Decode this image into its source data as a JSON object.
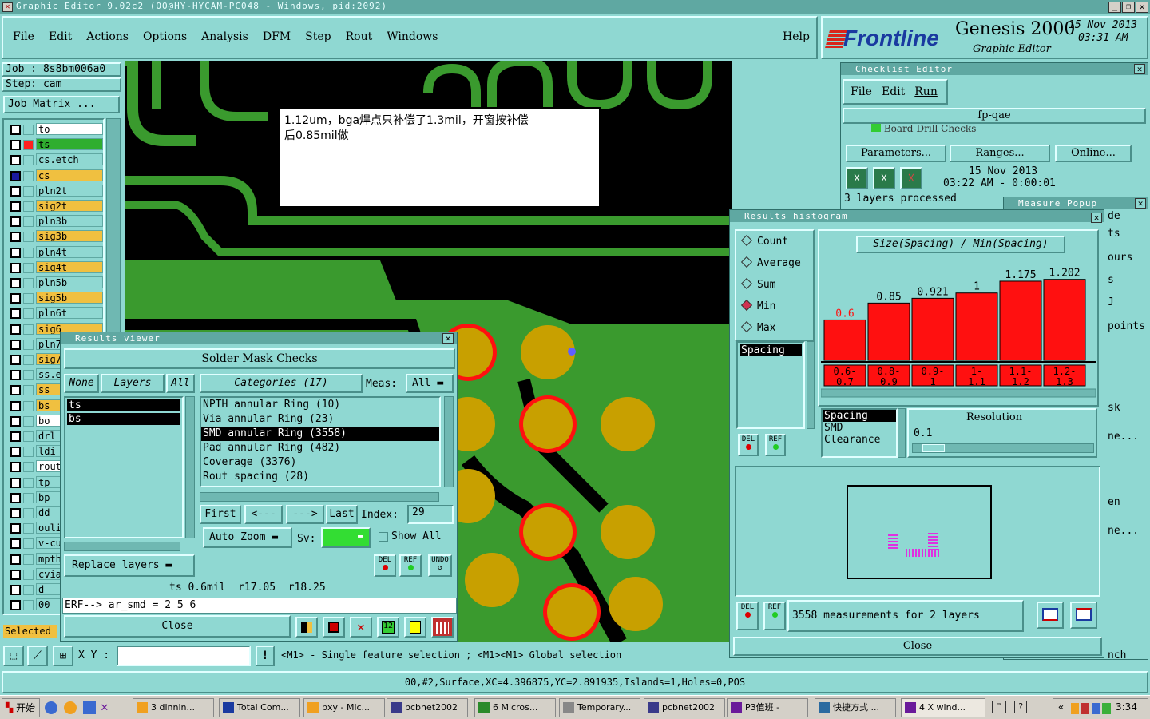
{
  "window": {
    "title": "Graphic Editor 9.02c2  (OO@HY-HYCAM-PC048 - Windows, pid:2092)"
  },
  "menu": [
    "File",
    "Edit",
    "Actions",
    "Options",
    "Analysis",
    "DFM",
    "Step",
    "Rout",
    "Windows"
  ],
  "help_label": "Help",
  "brand": {
    "logo": "Frontline",
    "product": "Genesis 2000",
    "subtitle": "Graphic Editor",
    "date": "15 Nov 2013",
    "time": "03:31 AM"
  },
  "job": {
    "job_label": "Job : 8s8bm006a0",
    "step_label": "Step: cam",
    "matrix_button": "Job Matrix ..."
  },
  "layers": [
    {
      "name": "to",
      "color": "#ffffff"
    },
    {
      "name": "ts",
      "color": "#2fae2f"
    },
    {
      "name": "cs.etch",
      "color": "#8fd8d2"
    },
    {
      "name": "cs",
      "color": "#f0c040"
    },
    {
      "name": "pln2t",
      "color": "#8fd8d2"
    },
    {
      "name": "sig2t",
      "color": "#f0c040"
    },
    {
      "name": "pln3b",
      "color": "#8fd8d2"
    },
    {
      "name": "sig3b",
      "color": "#f0c040"
    },
    {
      "name": "pln4t",
      "color": "#8fd8d2"
    },
    {
      "name": "sig4t",
      "color": "#f0c040"
    },
    {
      "name": "pln5b",
      "color": "#8fd8d2"
    },
    {
      "name": "sig5b",
      "color": "#f0c040"
    },
    {
      "name": "pln6t",
      "color": "#8fd8d2"
    },
    {
      "name": "sig6",
      "color": "#f0c040"
    },
    {
      "name": "pln7",
      "color": "#8fd8d2"
    },
    {
      "name": "sig7",
      "color": "#f0c040"
    },
    {
      "name": "ss.e",
      "color": "#8fd8d2"
    },
    {
      "name": "ss",
      "color": "#f0c040"
    },
    {
      "name": "bs",
      "color": "#f0c040"
    },
    {
      "name": "bo",
      "color": "#ffffff"
    },
    {
      "name": "drl",
      "color": "#8fd8d2"
    },
    {
      "name": "ldi",
      "color": "#8fd8d2"
    },
    {
      "name": "rout",
      "color": "#ffffff"
    },
    {
      "name": "tp",
      "color": "#8fd8d2"
    },
    {
      "name": "bp",
      "color": "#8fd8d2"
    },
    {
      "name": "dd",
      "color": "#8fd8d2"
    },
    {
      "name": "ouli",
      "color": "#8fd8d2"
    },
    {
      "name": "v-cu",
      "color": "#8fd8d2"
    },
    {
      "name": "mpth",
      "color": "#8fd8d2"
    },
    {
      "name": "cvia",
      "color": "#8fd8d2"
    },
    {
      "name": "d",
      "color": "#8fd8d2"
    },
    {
      "name": "00",
      "color": "#8fd8d2"
    }
  ],
  "selected_label": "Selected",
  "note": {
    "line1": "1.12um，bga焊点只补偿了1.3mil，开窗按补偿",
    "line2": "后0.85mil做"
  },
  "results_viewer": {
    "title": "Results viewer",
    "header": "Solder Mask Checks",
    "none_btn": "None",
    "layers_btn": "Layers",
    "all_btn": "All",
    "categories_btn": "Categories (17)",
    "meas_label": "Meas:",
    "meas_value": "All",
    "layers": [
      "ts",
      "bs"
    ],
    "categories": [
      "NPTH annular Ring (10)",
      "Via annular Ring (23)",
      "SMD annular Ring (3558)",
      "Pad annular Ring (482)",
      "Coverage (3376)",
      "Rout spacing (28)"
    ],
    "first_btn": "First",
    "prev_btn": "<---",
    "next_btn": "--->",
    "last_btn": "Last",
    "index_label": "Index:",
    "index_value": "29",
    "autozoom_btn": "Auto Zoom",
    "sv_label": "Sv:",
    "show_all": "Show All",
    "replace_btn": "Replace layers",
    "del": "DEL",
    "ref": "REF",
    "undo": "UNDO",
    "measure_line": "ts 0.6mil  r17.05  r18.25",
    "erf_line": "ERF--> ar_smd = 2 5 6",
    "close_btn": "Close"
  },
  "checklist": {
    "title": "Checklist Editor",
    "menu": [
      "File",
      "Edit",
      "Run"
    ],
    "name": "fp-qae",
    "row_text": "Board-Drill Checks",
    "params_btn": "Parameters...",
    "ranges_btn": "Ranges...",
    "online_btn": "Online...",
    "run_date": "15 Nov 2013",
    "run_time": "03:22 AM - 0:00:01",
    "status": "3 layers processed",
    "measure_popup": "Measure Popup",
    "side_labels": [
      "de",
      "ts",
      "ours",
      "s",
      "J",
      "points",
      "sk",
      "ne...",
      "en",
      "ne...",
      "nch"
    ]
  },
  "histogram": {
    "title": "Results histogram",
    "modes": [
      {
        "label": "Count",
        "on": false
      },
      {
        "label": "Average",
        "on": false
      },
      {
        "label": "Sum",
        "on": false
      },
      {
        "label": "Min",
        "on": true
      },
      {
        "label": "Max",
        "on": false
      }
    ],
    "list": [
      "Spacing"
    ],
    "chart_title": "Size(Spacing) / Min(Spacing)",
    "types": [
      "Spacing",
      "SMD",
      "Clearance"
    ],
    "resolution_label": "Resolution",
    "resolution_value": "0.1",
    "summary": "3558 measurements for 2 layers",
    "del": "DEL",
    "ref": "REF",
    "close_btn": "Close"
  },
  "chart_data": {
    "type": "bar",
    "categories": [
      "0.6-0.7",
      "0.8-0.9",
      "0.9-1",
      "1-1.1",
      "1.1-1.2",
      "1.2-1.3"
    ],
    "values": [
      0.6,
      0.85,
      0.921,
      1,
      1.175,
      1.202
    ],
    "labels": [
      "0.6",
      "0.85",
      "0.921",
      "1",
      "1.175",
      "1.202"
    ],
    "title": "Size(Spacing) / Min(Spacing)",
    "bar_color": "#ff1010"
  },
  "bottom": {
    "xy_label": "X Y :",
    "xy_value": "",
    "hint": "<M1> - Single feature selection ; <M1><M1> Global selection",
    "status": "00,#2,Surface,XC=4.396875,YC=2.891935,Islands=1,Holes=0,POS"
  },
  "taskbar": {
    "start": "开始",
    "items": [
      "3 dinnin...",
      "Total Com...",
      "pxy - Mic...",
      "pcbnet2002",
      "6 Micros...",
      "Temporary...",
      "pcbnet2002",
      "P3值班 -",
      "快捷方式 ...",
      "4 X wind..."
    ],
    "clock": "3:34"
  }
}
